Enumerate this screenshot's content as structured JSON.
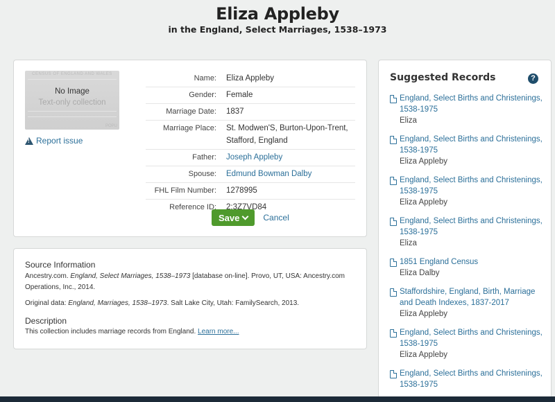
{
  "header": {
    "title": "Eliza Appleby",
    "subtitle": "in the England, Select Marriages, 1538–1973"
  },
  "thumbnail": {
    "faint_header": "CENSUS OF ENGLAND AND WALES",
    "no_image": "No Image",
    "text_only": "Text-only collection",
    "corner": "POPU"
  },
  "report_issue": "Report issue",
  "fields": [
    {
      "label": "Name:",
      "value": "Eliza Appleby",
      "link": false
    },
    {
      "label": "Gender:",
      "value": "Female",
      "link": false
    },
    {
      "label": "Marriage Date:",
      "value": "1837",
      "link": false
    },
    {
      "label": "Marriage Place:",
      "value": "St. Modwen'S, Burton-Upon-Trent, Stafford, England",
      "link": false
    },
    {
      "label": "Father:",
      "value": "Joseph Appleby",
      "link": true
    },
    {
      "label": "Spouse:",
      "value": "Edmund Bowman Dalby",
      "link": true
    },
    {
      "label": "FHL Film Number:",
      "value": "1278995",
      "link": false
    },
    {
      "label": "Reference ID:",
      "value": "2:3Z7VD84",
      "link": false
    }
  ],
  "actions": {
    "save": "Save",
    "cancel": "Cancel"
  },
  "source": {
    "heading": "Source Information",
    "citation_pre": "Ancestry.com. ",
    "citation_title": "England, Select Marriages, 1538–1973",
    "citation_post": " [database on-line]. Provo, UT, USA: Ancestry.com Operations, Inc., 2014.",
    "original_pre": "Original data: ",
    "original_title": "England, Marriages, 1538–1973",
    "original_post": ". Salt Lake City, Utah: FamilySearch, 2013.",
    "description_heading": "Description",
    "description_text": "This collection includes marriage records from England.",
    "learn_more": "Learn more..."
  },
  "suggested": {
    "title": "Suggested Records",
    "items": [
      {
        "title": "England, Select Births and Christenings, 1538-1975",
        "name": "Eliza"
      },
      {
        "title": "England, Select Births and Christenings, 1538-1975",
        "name": "Eliza Appleby"
      },
      {
        "title": "England, Select Births and Christenings, 1538-1975",
        "name": "Eliza Appleby"
      },
      {
        "title": "England, Select Births and Christenings, 1538-1975",
        "name": "Eliza"
      },
      {
        "title": "1851 England Census",
        "name": "Eliza Dalby"
      },
      {
        "title": "Staffordshire, England, Birth, Marriage and Death Indexes, 1837-2017",
        "name": "Eliza Appleby"
      },
      {
        "title": "England, Select Births and Christenings, 1538-1975",
        "name": "Eliza Appleby"
      },
      {
        "title": "England, Select Births and Christenings, 1538-1975",
        "name": ""
      }
    ]
  },
  "colors": {
    "link": "#2b6f99",
    "save_button": "#4f9a2c",
    "background": "#eef0ef"
  }
}
